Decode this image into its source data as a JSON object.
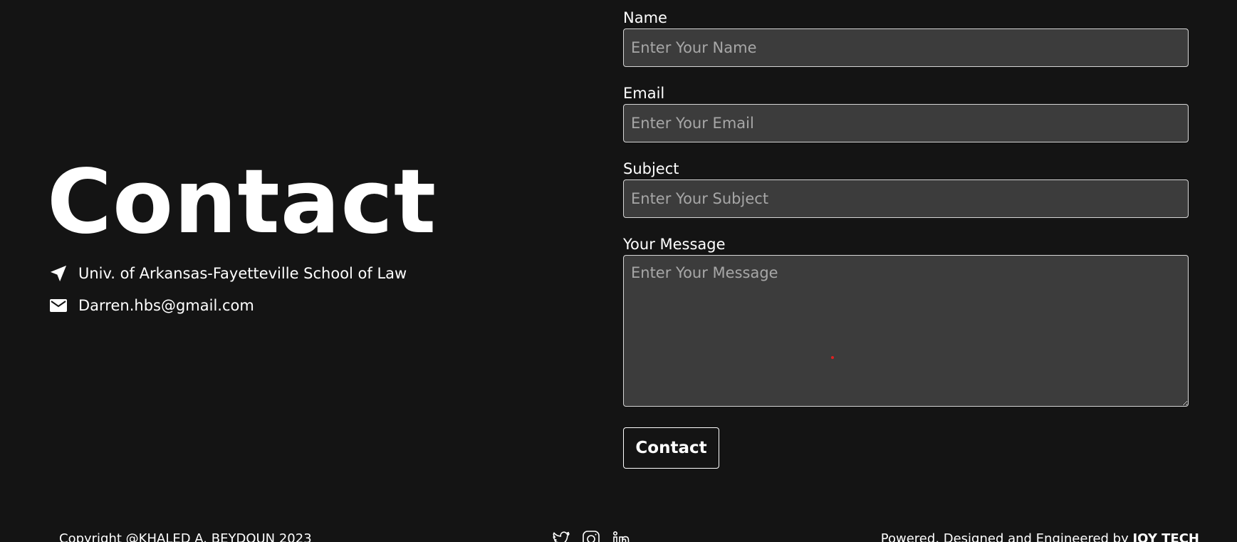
{
  "hero": {
    "title": "Contact",
    "address": "Univ. of Arkansas-Fayetteville School of Law",
    "email": "Darren.hbs@gmail.com"
  },
  "form": {
    "name_label": "Name",
    "name_placeholder": "Enter Your Name",
    "email_label": "Email",
    "email_placeholder": "Enter Your Email",
    "subject_label": "Subject",
    "subject_placeholder": "Enter Your Subject",
    "message_label": "Your Message",
    "message_placeholder": "Enter Your Message",
    "submit_label": "Contact"
  },
  "footer": {
    "copyright": "Copyright @KHALED A. BEYDOUN 2023",
    "powered_prefix": "Powered, Designed and Engineered by",
    "powered_brand": "JOY TECH",
    "social_icons": [
      "twitter-icon",
      "instagram-icon",
      "linkedin-icon"
    ]
  },
  "colors": {
    "background": "#141414",
    "input_background": "#3c3c3c",
    "input_border": "#d6d6d6",
    "placeholder": "#a7a7a7",
    "text": "#ffffff",
    "cursor_dot": "#e02020"
  }
}
